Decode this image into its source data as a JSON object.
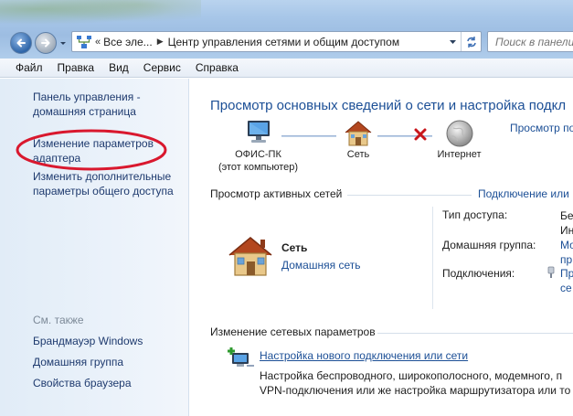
{
  "address_bar": {
    "overflow": "«",
    "crumbs": [
      "Все эле...",
      "Центр управления сетями и общим доступом"
    ]
  },
  "search": {
    "placeholder": "Поиск в панели"
  },
  "menu": [
    "Файл",
    "Правка",
    "Вид",
    "Сервис",
    "Справка"
  ],
  "sidebar": {
    "links": [
      {
        "label": "Панель управления - домашняя страница"
      },
      {
        "label": "Изменение параметров адаптера",
        "circled": true
      },
      {
        "label": "Изменить дополнительные параметры общего доступа"
      }
    ],
    "see_also_title": "См. также",
    "see_also": [
      "Брандмауэр Windows",
      "Домашняя группа",
      "Свойства браузера"
    ]
  },
  "main": {
    "heading": "Просмотр основных сведений о сети и настройка подкл",
    "view_full_map": "Просмотр полн",
    "map": {
      "computer": {
        "name": "ОФИС-ПК",
        "sub": "(этот компьютер)"
      },
      "network": "Сеть",
      "internet": "Интернет"
    },
    "active_title": "Просмотр активных сетей",
    "connect_link": "Подключение или",
    "network": {
      "name": "Сеть",
      "type": "Домашняя сеть"
    },
    "props": {
      "access_type_label": "Тип доступа:",
      "access_type_value": "Бе\nИн",
      "homegroup_label": "Домашняя группа:",
      "homegroup_value": "Мо\nпр",
      "connections_label": "Подключения:",
      "connections_value": "Пр\nсе"
    },
    "change_title": "Изменение сетевых параметров",
    "task": {
      "link": "Настройка нового подключения или сети",
      "desc1": "Настройка беспроводного, широкополосного, модемного, п",
      "desc2": "VPN-подключения или же настройка маршрутизатора или то"
    }
  },
  "colors": {
    "link": "#1c4f96",
    "accent_oval": "#d9182e"
  }
}
